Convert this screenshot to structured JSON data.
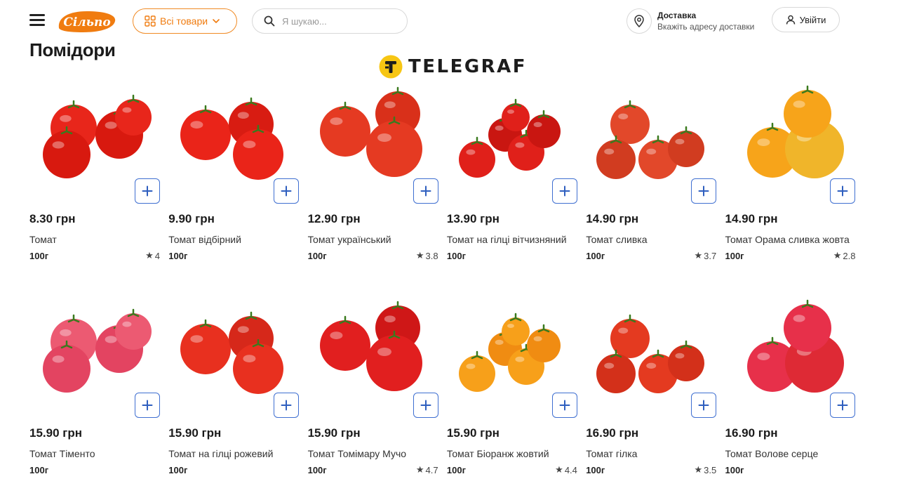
{
  "header": {
    "catalog_label": "Всі товари",
    "search_placeholder": "Я шукаю...",
    "delivery_title": "Доставка",
    "delivery_subtitle": "Вкажіть адресу доставки",
    "login_label": "Увійти",
    "logo_text": "Сільпо",
    "brand_color": "#f07c10",
    "accent_color": "#3f6fd1"
  },
  "page_title": "Помідори",
  "watermark": "TELEGRAF",
  "products": [
    {
      "price": "8.30 грн",
      "name": "Томат",
      "weight": "100г",
      "rating": "4",
      "colors": [
        "#e8261b",
        "#d8190f"
      ]
    },
    {
      "price": "9.90 грн",
      "name": "Томат відбірний",
      "weight": "100г",
      "rating": "",
      "colors": [
        "#ea2419",
        "#d81c12"
      ]
    },
    {
      "price": "12.90 грн",
      "name": "Томат український",
      "weight": "100г",
      "rating": "3.8",
      "colors": [
        "#e53a22",
        "#d9301a"
      ]
    },
    {
      "price": "13.90 грн",
      "name": "Томат на гілці вітчизняний",
      "weight": "100г",
      "rating": "",
      "colors": [
        "#e0201a",
        "#c91611"
      ]
    },
    {
      "price": "14.90 грн",
      "name": "Томат сливка",
      "weight": "100г",
      "rating": "3.7",
      "colors": [
        "#e2482a",
        "#d13c20"
      ]
    },
    {
      "price": "14.90 грн",
      "name": "Томат Орама сливка жовта",
      "weight": "100г",
      "rating": "2.8",
      "colors": [
        "#f7a41a",
        "#f0b52a"
      ]
    },
    {
      "price": "15.90 грн",
      "name": "Томат Тіменто",
      "weight": "100г",
      "rating": "",
      "colors": [
        "#ec5a72",
        "#e34461"
      ]
    },
    {
      "price": "15.90 грн",
      "name": "Томат на гілці рожевий",
      "weight": "100г",
      "rating": "",
      "colors": [
        "#e8301f",
        "#d6281a"
      ]
    },
    {
      "price": "15.90 грн",
      "name": "Томат Томімару Мучо",
      "weight": "100г",
      "rating": "4.7",
      "colors": [
        "#e11f1f",
        "#cf1717"
      ]
    },
    {
      "price": "15.90 грн",
      "name": "Томат Біоранж жовтий",
      "weight": "100г",
      "rating": "4.4",
      "colors": [
        "#f7a01a",
        "#f08c12"
      ]
    },
    {
      "price": "16.90 грн",
      "name": "Томат гілка",
      "weight": "100г",
      "rating": "3.5",
      "colors": [
        "#e43a20",
        "#d3301a"
      ]
    },
    {
      "price": "16.90 грн",
      "name": "Томат Волове серце",
      "weight": "100г",
      "rating": "",
      "colors": [
        "#e7304a",
        "#de2a35"
      ]
    }
  ]
}
